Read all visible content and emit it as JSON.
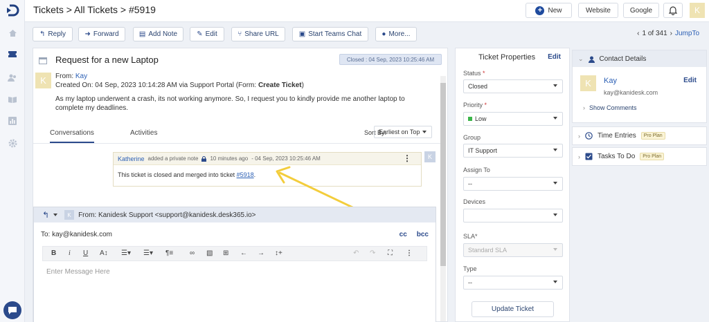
{
  "header": {
    "breadcrumb": "Tickets > All Tickets > #5919",
    "new_label": "New",
    "website_label": "Website",
    "google_label": "Google",
    "avatar_letter": "K"
  },
  "toolbar": {
    "reply": "Reply",
    "forward": "Forward",
    "add_note": "Add Note",
    "edit": "Edit",
    "share_url": "Share URL",
    "teams_chat": "Start Teams Chat",
    "more": "More...",
    "pager_pos": "1 of 341",
    "jump_to": "JumpTo"
  },
  "ticket": {
    "subject": "Request for a new Laptop",
    "closed_badge": "Closed : 04 Sep, 2023 10:25:46 AM",
    "avatar_letter": "K",
    "from_label": "From:",
    "from_name": "Kay",
    "created_prefix": "Created On: 04 Sep, 2023 10:14:28 AM via Support Portal (Form:",
    "created_form": "Create Ticket",
    "created_suffix": ")",
    "description": "As my laptop underwent a crash, its not working anymore. So, I request you to kindly provide me another laptop to complete my deadlines."
  },
  "tabs": {
    "conversations": "Conversations",
    "activities": "Activities",
    "sort_by": "Sort By:",
    "sort_value": "Earliest on Top"
  },
  "note": {
    "author": "Katherine",
    "action": "added a private note",
    "time_ago": "10 minutes ago",
    "timestamp": "- 04 Sep, 2023 10:25:46 AM",
    "body_prefix": "This ticket is closed and merged into ticket",
    "ticket_link": "#5918",
    "body_suffix": ".",
    "avatar_letter": "K"
  },
  "compose": {
    "avatar_letter": "K",
    "from": "From: Kanidesk Support <support@kanidesk.desk365.io>",
    "to": "To: kay@kanidesk.com",
    "cc": "cc",
    "bcc": "bcc",
    "placeholder": "Enter Message Here"
  },
  "properties": {
    "title": "Ticket Properties",
    "edit": "Edit",
    "status_label": "Status",
    "status_value": "Closed",
    "priority_label": "Priority",
    "priority_value": "Low",
    "group_label": "Group",
    "group_value": "IT Support",
    "assign_label": "Assign To",
    "assign_value": "--",
    "devices_label": "Devices",
    "devices_value": "",
    "sla_label": "SLA*",
    "sla_value": "Standard SLA",
    "type_label": "Type",
    "type_value": "--",
    "required_mark": "*",
    "update_button": "Update Ticket"
  },
  "contact": {
    "title": "Contact Details",
    "avatar_letter": "K",
    "name": "Kay",
    "email": "kay@kanidesk.com",
    "edit": "Edit",
    "show_comments": "Show Comments"
  },
  "time_entries": {
    "title": "Time Entries",
    "badge": "Pro Plan"
  },
  "tasks": {
    "title": "Tasks To Do",
    "badge": "Pro Plan"
  },
  "colors": {
    "brand": "#2b4a8b",
    "link": "#2b5fb4",
    "avatar": "#efe3b3",
    "priority_low": "#3bb54a"
  }
}
